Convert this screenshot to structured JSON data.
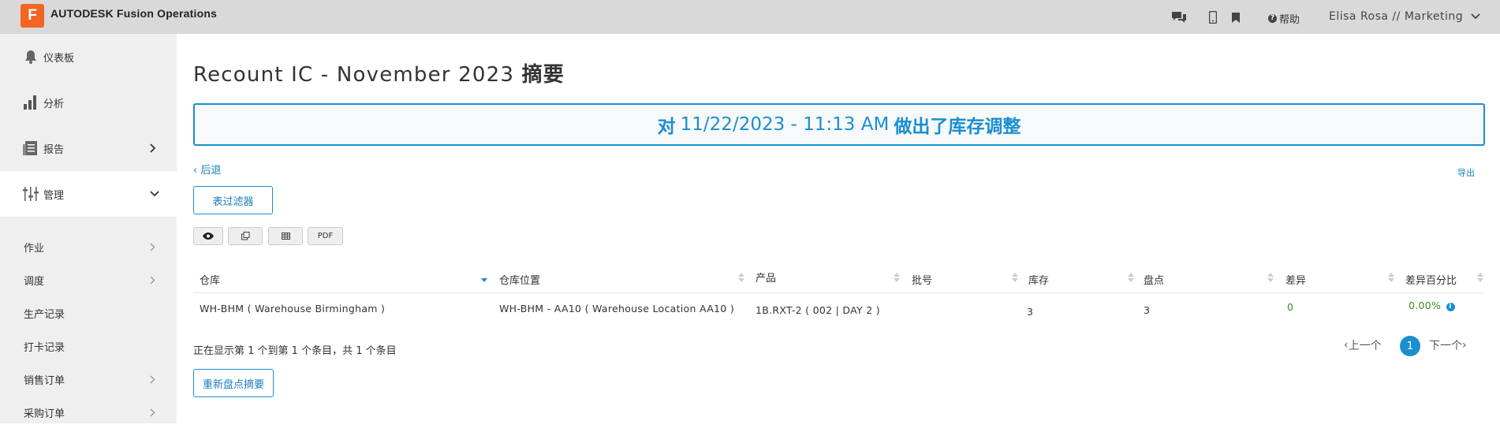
{
  "app": {
    "logo_letter": "F",
    "brand": "AUTODESK Fusion Operations",
    "help_label": "帮助",
    "user_label": "Elisa Rosa // Marketing"
  },
  "sidebar": {
    "items": [
      {
        "label": "仪表板",
        "icon": "bell-icon"
      },
      {
        "label": "分析",
        "icon": "bar-chart-icon"
      },
      {
        "label": "报告",
        "icon": "report-icon"
      },
      {
        "label": "管理",
        "icon": "sliders-icon"
      }
    ],
    "subitems": [
      {
        "label": "作业"
      },
      {
        "label": "调度"
      },
      {
        "label": "生产记录"
      },
      {
        "label": "打卡记录"
      },
      {
        "label": "销售订单"
      },
      {
        "label": "采购订单"
      }
    ]
  },
  "page": {
    "title_main": "Recount IC - November 2023",
    "title_bold": "摘要",
    "banner_pre": "对",
    "banner_date": "11/22/2023 - 11:13 AM",
    "banner_post": "做出了库存调整",
    "back_label": "后退",
    "export_label": "导出",
    "filter_button": "表过滤器",
    "toolbar": {
      "pdf_label": "PDF"
    }
  },
  "table": {
    "headers": [
      "仓库",
      "仓库位置",
      "产品",
      "批号",
      "库存",
      "盘点",
      "差异",
      "差异百分比"
    ],
    "rows": [
      {
        "warehouse": "WH-BHM ( Warehouse Birmingham )",
        "location": "WH-BHM - AA10 ( Warehouse Location AA10 )",
        "product": "1B.RXT-2 ( 002 | DAY 2 )",
        "lot": "",
        "stock": "3",
        "count": "3",
        "diff": "0",
        "diff_pct": "0.00%"
      }
    ]
  },
  "pagination": {
    "showing": "正在显示第 1 个到第 1 个条目，共 1 个条目",
    "prev": "上一个",
    "current": "1",
    "next": "下一个"
  },
  "footer": {
    "recount_button": "重新盘点摘要"
  },
  "colors": {
    "accent": "#1a8fd0",
    "brand": "#f26522",
    "green": "#3c8a2e"
  }
}
